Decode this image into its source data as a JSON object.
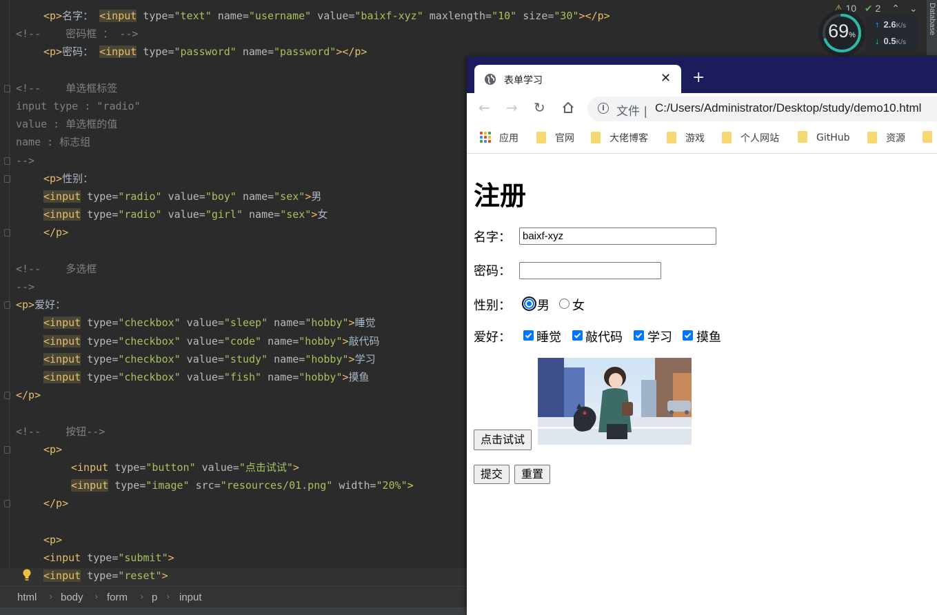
{
  "editor": {
    "lines": [
      [
        [
          "tag",
          "<p>"
        ],
        [
          "text",
          "名字： "
        ],
        [
          "taghl",
          "<input"
        ],
        [
          "attr",
          " type="
        ],
        [
          "str",
          "\"text\""
        ],
        [
          "attr",
          " name="
        ],
        [
          "str",
          "\"username\""
        ],
        [
          "attr",
          " value="
        ],
        [
          "str",
          "\"baixf-xyz\""
        ],
        [
          "attr",
          " maxlength="
        ],
        [
          "str",
          "\"10\""
        ],
        [
          "attr",
          " size="
        ],
        [
          "str",
          "\"30\""
        ],
        [
          "tag",
          "></p>"
        ]
      ],
      [
        [
          "comment",
          "<!--    密码框 ： -->"
        ]
      ],
      [
        [
          "tag",
          "<p>"
        ],
        [
          "text",
          "密码： "
        ],
        [
          "taghl",
          "<input"
        ],
        [
          "attr",
          " type="
        ],
        [
          "str",
          "\"password\""
        ],
        [
          "attr",
          " name="
        ],
        [
          "str",
          "\"password\""
        ],
        [
          "tag",
          "></p>"
        ]
      ],
      [],
      [
        [
          "comment",
          "<!--    单选框标签"
        ]
      ],
      [
        [
          "comment",
          "input type : \"radio\""
        ]
      ],
      [
        [
          "comment",
          "value : 单选框的值"
        ]
      ],
      [
        [
          "comment",
          "name : 标志组"
        ]
      ],
      [
        [
          "comment",
          "-->"
        ]
      ],
      [
        [
          "tag",
          "<p>"
        ],
        [
          "text",
          "性别："
        ]
      ],
      [
        [
          "taghl",
          "<input"
        ],
        [
          "attr",
          " type="
        ],
        [
          "str",
          "\"radio\""
        ],
        [
          "attr",
          " value="
        ],
        [
          "str",
          "\"boy\""
        ],
        [
          "attr",
          " name="
        ],
        [
          "str",
          "\"sex\""
        ],
        [
          "tag",
          ">"
        ],
        [
          "text",
          "男"
        ]
      ],
      [
        [
          "taghl",
          "<input"
        ],
        [
          "attr",
          " type="
        ],
        [
          "str",
          "\"radio\""
        ],
        [
          "attr",
          " value="
        ],
        [
          "str",
          "\"girl\""
        ],
        [
          "attr",
          " name="
        ],
        [
          "str",
          "\"sex\""
        ],
        [
          "tag",
          ">"
        ],
        [
          "text",
          "女"
        ]
      ],
      [
        [
          "tag",
          "</p>"
        ]
      ],
      [],
      [
        [
          "comment",
          "<!--    多选框"
        ]
      ],
      [
        [
          "comment",
          "-->"
        ]
      ],
      [
        [
          "tag",
          "<p>"
        ],
        [
          "text",
          "爱好："
        ]
      ],
      [
        [
          "taghl",
          "<input"
        ],
        [
          "attr",
          " type="
        ],
        [
          "str",
          "\"checkbox\""
        ],
        [
          "attr",
          " value="
        ],
        [
          "str",
          "\"sleep\""
        ],
        [
          "attr",
          " name="
        ],
        [
          "str",
          "\"hobby\""
        ],
        [
          "tag",
          ">"
        ],
        [
          "text",
          "睡觉"
        ]
      ],
      [
        [
          "taghl",
          "<input"
        ],
        [
          "attr",
          " type="
        ],
        [
          "str",
          "\"checkbox\""
        ],
        [
          "attr",
          " value="
        ],
        [
          "str",
          "\"code\""
        ],
        [
          "attr",
          " name="
        ],
        [
          "str",
          "\"hobby\""
        ],
        [
          "tag",
          ">"
        ],
        [
          "text",
          "敲代码"
        ]
      ],
      [
        [
          "taghl",
          "<input"
        ],
        [
          "attr",
          " type="
        ],
        [
          "str",
          "\"checkbox\""
        ],
        [
          "attr",
          " value="
        ],
        [
          "str",
          "\"study\""
        ],
        [
          "attr",
          " name="
        ],
        [
          "str",
          "\"hobby\""
        ],
        [
          "tag",
          ">"
        ],
        [
          "text",
          "学习"
        ]
      ],
      [
        [
          "taghl",
          "<input"
        ],
        [
          "attr",
          " type="
        ],
        [
          "str",
          "\"checkbox\""
        ],
        [
          "attr",
          " value="
        ],
        [
          "str",
          "\"fish\""
        ],
        [
          "attr",
          " name="
        ],
        [
          "str",
          "\"hobby\""
        ],
        [
          "tag",
          ">"
        ],
        [
          "text",
          "摸鱼"
        ]
      ],
      [
        [
          "tag",
          "</p>"
        ]
      ],
      [],
      [
        [
          "comment",
          "<!--    按钮-->"
        ]
      ],
      [
        [
          "tag",
          "<p>"
        ]
      ],
      [
        [
          "tag",
          "<input"
        ],
        [
          "attr",
          " type="
        ],
        [
          "str",
          "\"button\""
        ],
        [
          "attr",
          " value="
        ],
        [
          "str",
          "\"点击试试\""
        ],
        [
          "tag",
          ">"
        ]
      ],
      [
        [
          "taghl",
          "<input"
        ],
        [
          "attr",
          " type="
        ],
        [
          "str",
          "\"image\""
        ],
        [
          "attr",
          " src="
        ],
        [
          "str",
          "\"resources/01.png\""
        ],
        [
          "attr",
          " width="
        ],
        [
          "str",
          "\"20%\""
        ],
        [
          "tag",
          ">"
        ]
      ],
      [
        [
          "tag",
          "</p>"
        ]
      ],
      [],
      [
        [
          "tag",
          "<p>"
        ]
      ],
      [
        [
          "tag",
          "<input"
        ],
        [
          "attr",
          " type="
        ],
        [
          "str",
          "\"submit\""
        ],
        [
          "tag",
          ">"
        ]
      ],
      [
        [
          "taghl",
          "<input"
        ],
        [
          "attr",
          " type="
        ],
        [
          "str",
          "\"reset\""
        ],
        [
          "tag",
          ">"
        ]
      ]
    ],
    "indents": [
      2,
      0,
      2,
      0,
      0,
      0,
      0,
      0,
      0,
      2,
      2,
      2,
      2,
      0,
      0,
      0,
      0,
      2,
      2,
      2,
      2,
      0,
      0,
      0,
      2,
      4,
      4,
      2,
      0,
      2,
      2,
      2
    ]
  },
  "breadcrumb": [
    "html",
    "body",
    "form",
    "p",
    "input"
  ],
  "inspections": {
    "warnings": "10",
    "ok": "2"
  },
  "sidebar_label": "Database",
  "monitor": {
    "percent": "69",
    "percent_unit": "%",
    "up": "2.6",
    "down": "0.5",
    "unit": "K/s",
    "fraction": 0.69
  },
  "browser": {
    "tab_title": "表单学习",
    "scheme_label": "文件 |",
    "url": "C:/Users/Administrator/Desktop/study/demo10.html",
    "bookmarks": [
      "应用",
      "官网",
      "大佬博客",
      "游戏",
      "个人网站",
      "GitHub",
      "资源"
    ]
  },
  "form": {
    "heading": "注册",
    "name_label": "名字：",
    "name_value": "baixf-xyz",
    "password_label": "密码：",
    "password_value": "",
    "gender_label": "性别：",
    "gender_options": [
      "男",
      "女"
    ],
    "gender_selected": 0,
    "hobby_label": "爱好：",
    "hobbies": [
      "睡觉",
      "敲代码",
      "学习",
      "摸鱼"
    ],
    "button_label": "点击试试",
    "submit_label": "提交",
    "reset_label": "重置"
  },
  "colors": {
    "accent": "#0075ff",
    "tabstrip": "#1c1b5c",
    "editor_bg": "#2b2b2b"
  }
}
